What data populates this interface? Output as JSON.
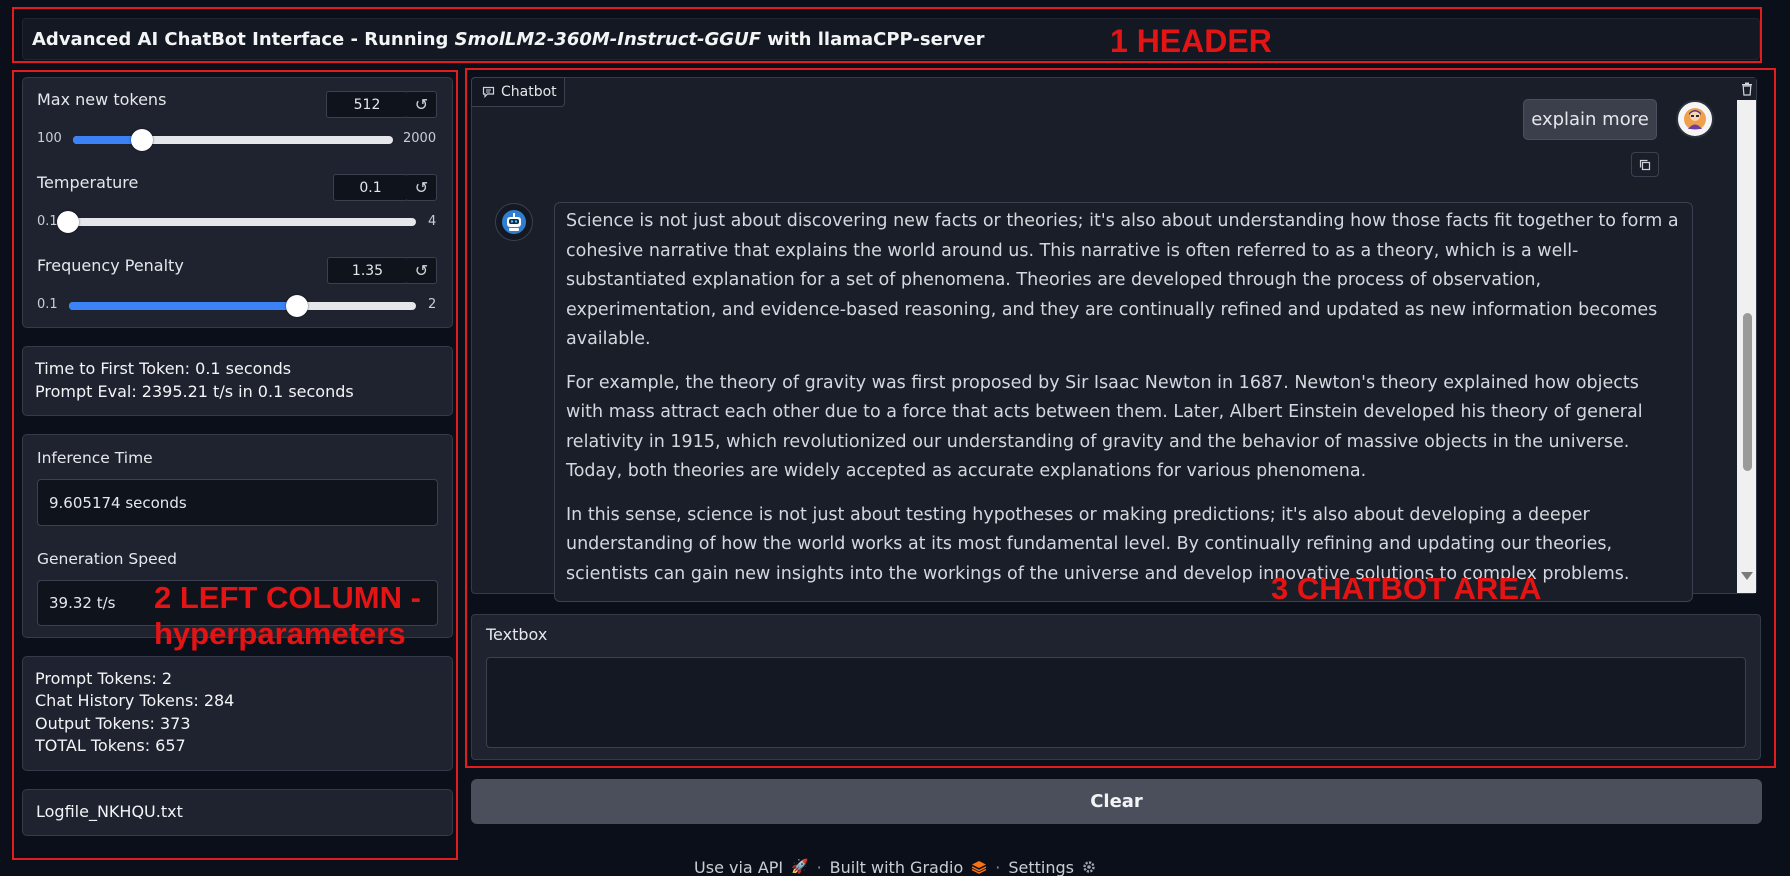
{
  "header": {
    "title_prefix": "Advanced AI ChatBot Interface - Running ",
    "model": "SmolLM2-360M-Instruct-GGUF",
    "title_suffix": " with llamaCPP-server"
  },
  "annotations": {
    "header": "1 HEADER",
    "left_line1": "2 LEFT COLUMN -",
    "left_line2": "hyperparameters",
    "chat": "3 CHATBOT AREA"
  },
  "params": {
    "max_new_tokens": {
      "label": "Max new tokens",
      "value": "512",
      "min": "100",
      "max": "2000",
      "fraction": 0.217
    },
    "temperature": {
      "label": "Temperature",
      "value": "0.1",
      "min": "0.1",
      "max": "4",
      "fraction": 0.0
    },
    "frequency_penalty": {
      "label": "Frequency Penalty",
      "value": "1.35",
      "min": "0.1",
      "max": "2",
      "fraction": 0.658
    },
    "reset_icon": "↺"
  },
  "timing": {
    "first_token": "Time to First Token: 0.1 seconds",
    "prompt_eval": "Prompt Eval: 2395.21  t/s in 0.1 seconds"
  },
  "inference": {
    "time_label": "Inference Time",
    "time_value": "9.605174 seconds",
    "speed_label": "Generation Speed",
    "speed_value": "39.32  t/s"
  },
  "tokens": {
    "prompt": "Prompt Tokens: 2",
    "history": "Chat History Tokens: 284",
    "output": "Output Tokens: 373",
    "total": "TOTAL Tokens: 657"
  },
  "logfile": "Logfile_NKHQU.txt",
  "chat": {
    "tab_label": "Chatbot",
    "user_message": "explain more",
    "bot_paragraphs": [
      "Science is not just about discovering new facts or theories; it's also about understanding how those facts fit together to form a cohesive narrative that explains the world around us. This narrative is often referred to as a theory, which is a well-substantiated explanation for a set of phenomena. Theories are developed through the process of observation, experimentation, and evidence-based reasoning, and they are continually refined and updated as new information becomes available.",
      "For example, the theory of gravity was first proposed by Sir Isaac Newton in 1687. Newton's theory explained how objects with mass attract each other due to a force that acts between them. Later, Albert Einstein developed his theory of general relativity in 1915, which revolutionized our understanding of gravity and the behavior of massive objects in the universe. Today, both theories are widely accepted as accurate explanations for various phenomena.",
      "In this sense, science is not just about testing hypotheses or making predictions; it's also about developing a deeper understanding of how the world works at its most fundamental level. By continually refining and updating our theories, scientists can gain new insights into the workings of the universe and develop innovative solutions to complex problems."
    ]
  },
  "textbox": {
    "label": "Textbox",
    "value": ""
  },
  "clear_label": "Clear",
  "footer": {
    "api": "Use via API",
    "built": "Built with Gradio",
    "settings": "Settings",
    "separator": "·"
  },
  "colors": {
    "accent": "#3b82f6",
    "annotation": "#e11d1d",
    "background": "#0b0f19"
  }
}
